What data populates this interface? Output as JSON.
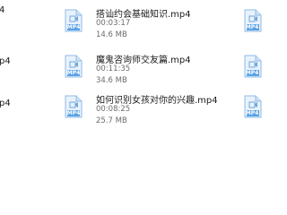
{
  "files": [
    {
      "name": "搭讪约会基础知识.mp4",
      "duration": "00:03:17",
      "size": "14.6 MB",
      "type": "MP4"
    },
    {
      "name": "魔鬼咨询师交友篇.mp4",
      "duration": "00:11:35",
      "size": "34.6 MB",
      "type": "MP4"
    },
    {
      "name": "如何识别女孩对你的兴趣.mp4",
      "duration": "00:08:25",
      "size": "25.7 MB",
      "type": "MP4"
    }
  ],
  "left_column": [
    {
      "fragment": "4"
    },
    {
      "fragment": "p4"
    },
    {
      "fragment": "p4"
    }
  ],
  "icon": {
    "name": "video-file-icon",
    "label": "MP4",
    "color": "#5aa2e6"
  }
}
